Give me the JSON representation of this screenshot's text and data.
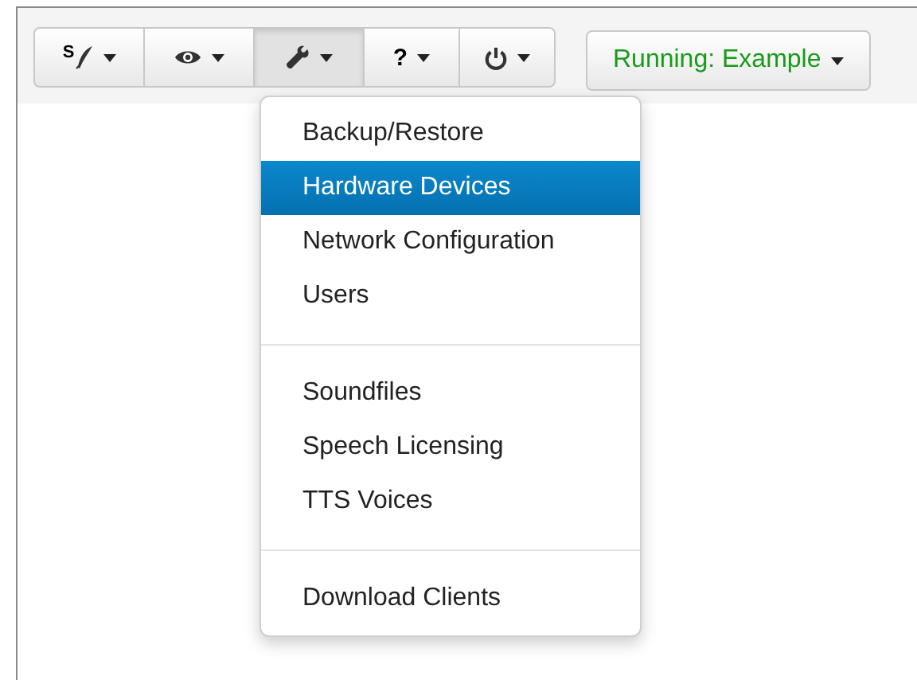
{
  "toolbar": {
    "buttons": [
      {
        "kind": "quill",
        "label": "S",
        "selected": false
      },
      {
        "kind": "eye",
        "selected": false
      },
      {
        "kind": "wrench",
        "selected": true
      },
      {
        "kind": "help",
        "label": "?",
        "selected": false
      },
      {
        "kind": "power",
        "selected": false
      }
    ]
  },
  "status_button": {
    "label": "Running: Example"
  },
  "menu": {
    "sections": [
      {
        "items": [
          {
            "label": "Backup/Restore",
            "selected": false
          },
          {
            "label": "Hardware Devices",
            "selected": true
          },
          {
            "label": "Network Configuration",
            "selected": false
          },
          {
            "label": "Users",
            "selected": false
          }
        ]
      },
      {
        "items": [
          {
            "label": "Soundfiles",
            "selected": false
          },
          {
            "label": "Speech Licensing",
            "selected": false
          },
          {
            "label": "TTS Voices",
            "selected": false
          }
        ]
      },
      {
        "items": [
          {
            "label": "Download Clients",
            "selected": false
          }
        ]
      }
    ]
  }
}
